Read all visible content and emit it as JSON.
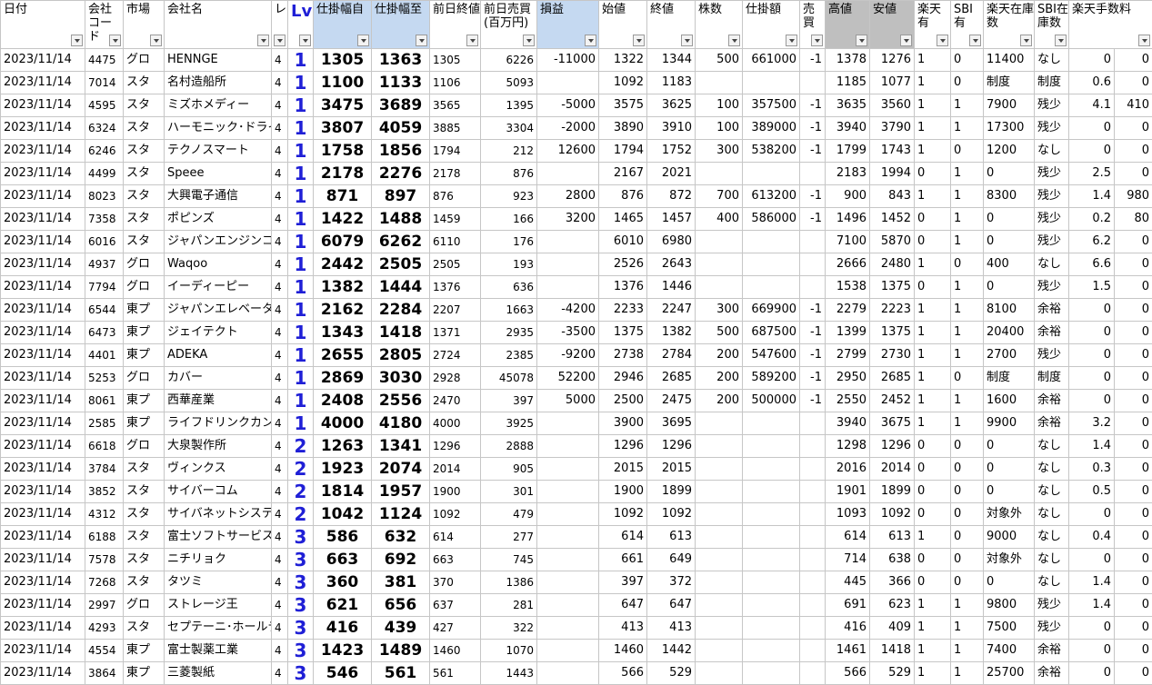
{
  "headers": [
    {
      "label": "日付",
      "style": ""
    },
    {
      "label": "会社コード",
      "style": ""
    },
    {
      "label": "市場",
      "style": ""
    },
    {
      "label": "会社名",
      "style": ""
    },
    {
      "label": "レ",
      "style": ""
    },
    {
      "label": "Lv",
      "style": "lv"
    },
    {
      "label": "仕掛幅自",
      "style": "blue"
    },
    {
      "label": "仕掛幅至",
      "style": "blue"
    },
    {
      "label": "前日終値",
      "style": ""
    },
    {
      "label": "前日売買(百万円)",
      "style": ""
    },
    {
      "label": "損益",
      "style": "blue"
    },
    {
      "label": "始値",
      "style": ""
    },
    {
      "label": "終値",
      "style": ""
    },
    {
      "label": "株数",
      "style": ""
    },
    {
      "label": "仕掛額",
      "style": ""
    },
    {
      "label": "売買",
      "style": ""
    },
    {
      "label": "高値",
      "style": "gray"
    },
    {
      "label": "安値",
      "style": "gray"
    },
    {
      "label": "楽天有",
      "style": ""
    },
    {
      "label": "SBI有",
      "style": ""
    },
    {
      "label": "楽天在庫数",
      "style": ""
    },
    {
      "label": "SBI在庫数",
      "style": ""
    },
    {
      "label": "楽天手数料",
      "style": ""
    }
  ],
  "rows": [
    [
      "2023/11/14",
      "4475",
      "グロ",
      "HENNGE",
      "4",
      "1",
      "1305",
      "1363",
      "1305",
      "6226",
      "-11000",
      "1322",
      "1344",
      "500",
      "661000",
      "-1",
      "1378",
      "1276",
      "1",
      "0",
      "11400",
      "なし",
      "0",
      "0"
    ],
    [
      "2023/11/14",
      "7014",
      "スタ",
      "名村造船所",
      "4",
      "1",
      "1100",
      "1133",
      "1106",
      "5093",
      "",
      "1092",
      "1183",
      "",
      "",
      "",
      "1185",
      "1077",
      "1",
      "0",
      "制度",
      "制度",
      "0.6",
      "0"
    ],
    [
      "2023/11/14",
      "4595",
      "スタ",
      "ミズホメディー",
      "4",
      "1",
      "3475",
      "3689",
      "3565",
      "1395",
      "-5000",
      "3575",
      "3625",
      "100",
      "357500",
      "-1",
      "3635",
      "3560",
      "1",
      "1",
      "7900",
      "残少",
      "4.1",
      "410"
    ],
    [
      "2023/11/14",
      "6324",
      "スタ",
      "ハーモニック･ドライブ",
      "4",
      "1",
      "3807",
      "4059",
      "3885",
      "3304",
      "-2000",
      "3890",
      "3910",
      "100",
      "389000",
      "-1",
      "3940",
      "3790",
      "1",
      "1",
      "17300",
      "残少",
      "0",
      "0"
    ],
    [
      "2023/11/14",
      "6246",
      "スタ",
      "テクノスマート",
      "4",
      "1",
      "1758",
      "1856",
      "1794",
      "212",
      "12600",
      "1794",
      "1752",
      "300",
      "538200",
      "-1",
      "1799",
      "1743",
      "1",
      "0",
      "1200",
      "なし",
      "0",
      "0"
    ],
    [
      "2023/11/14",
      "4499",
      "スタ",
      "Speee",
      "4",
      "1",
      "2178",
      "2276",
      "2178",
      "876",
      "",
      "2167",
      "2021",
      "",
      "",
      "",
      "2183",
      "1994",
      "0",
      "1",
      "0",
      "残少",
      "2.5",
      "0"
    ],
    [
      "2023/11/14",
      "8023",
      "スタ",
      "大興電子通信",
      "4",
      "1",
      "871",
      "897",
      "876",
      "923",
      "2800",
      "876",
      "872",
      "700",
      "613200",
      "-1",
      "900",
      "843",
      "1",
      "1",
      "8300",
      "残少",
      "1.4",
      "980"
    ],
    [
      "2023/11/14",
      "7358",
      "スタ",
      "ポピンズ",
      "4",
      "1",
      "1422",
      "1488",
      "1459",
      "166",
      "3200",
      "1465",
      "1457",
      "400",
      "586000",
      "-1",
      "1496",
      "1452",
      "0",
      "1",
      "0",
      "残少",
      "0.2",
      "80"
    ],
    [
      "2023/11/14",
      "6016",
      "スタ",
      "ジャパンエンジンコーポ",
      "4",
      "1",
      "6079",
      "6262",
      "6110",
      "176",
      "",
      "6010",
      "6980",
      "",
      "",
      "",
      "7100",
      "5870",
      "0",
      "1",
      "0",
      "残少",
      "6.2",
      "0"
    ],
    [
      "2023/11/14",
      "4937",
      "グロ",
      "Waqoo",
      "4",
      "1",
      "2442",
      "2505",
      "2505",
      "193",
      "",
      "2526",
      "2643",
      "",
      "",
      "",
      "2666",
      "2480",
      "1",
      "0",
      "400",
      "なし",
      "6.6",
      "0"
    ],
    [
      "2023/11/14",
      "7794",
      "グロ",
      "イーディーピー",
      "4",
      "1",
      "1382",
      "1444",
      "1376",
      "636",
      "",
      "1376",
      "1446",
      "",
      "",
      "",
      "1538",
      "1375",
      "0",
      "1",
      "0",
      "残少",
      "1.5",
      "0"
    ],
    [
      "2023/11/14",
      "6544",
      "東プ",
      "ジャパンエレベーター",
      "4",
      "1",
      "2162",
      "2284",
      "2207",
      "1663",
      "-4200",
      "2233",
      "2247",
      "300",
      "669900",
      "-1",
      "2279",
      "2223",
      "1",
      "1",
      "8100",
      "余裕",
      "0",
      "0"
    ],
    [
      "2023/11/14",
      "6473",
      "東プ",
      "ジェイテクト",
      "4",
      "1",
      "1343",
      "1418",
      "1371",
      "2935",
      "-3500",
      "1375",
      "1382",
      "500",
      "687500",
      "-1",
      "1399",
      "1375",
      "1",
      "1",
      "20400",
      "余裕",
      "0",
      "0"
    ],
    [
      "2023/11/14",
      "4401",
      "東プ",
      "ADEKA",
      "4",
      "1",
      "2655",
      "2805",
      "2724",
      "2385",
      "-9200",
      "2738",
      "2784",
      "200",
      "547600",
      "-1",
      "2799",
      "2730",
      "1",
      "1",
      "2700",
      "残少",
      "0",
      "0"
    ],
    [
      "2023/11/14",
      "5253",
      "グロ",
      "カバー",
      "4",
      "1",
      "2869",
      "3030",
      "2928",
      "45078",
      "52200",
      "2946",
      "2685",
      "200",
      "589200",
      "-1",
      "2950",
      "2685",
      "1",
      "0",
      "制度",
      "制度",
      "0",
      "0"
    ],
    [
      "2023/11/14",
      "8061",
      "東プ",
      "西華産業",
      "4",
      "1",
      "2408",
      "2556",
      "2470",
      "397",
      "5000",
      "2500",
      "2475",
      "200",
      "500000",
      "-1",
      "2550",
      "2452",
      "1",
      "1",
      "1600",
      "余裕",
      "0",
      "0"
    ],
    [
      "2023/11/14",
      "2585",
      "東プ",
      "ライフドリンクカンパニー",
      "4",
      "1",
      "4000",
      "4180",
      "4000",
      "3925",
      "",
      "3900",
      "3695",
      "",
      "",
      "",
      "3940",
      "3675",
      "1",
      "1",
      "9900",
      "余裕",
      "3.2",
      "0"
    ],
    [
      "2023/11/14",
      "6618",
      "グロ",
      "大泉製作所",
      "4",
      "2",
      "1263",
      "1341",
      "1296",
      "2888",
      "",
      "1296",
      "1296",
      "",
      "",
      "",
      "1298",
      "1296",
      "0",
      "0",
      "0",
      "なし",
      "1.4",
      "0"
    ],
    [
      "2023/11/14",
      "3784",
      "スタ",
      "ヴィンクス",
      "4",
      "2",
      "1923",
      "2074",
      "2014",
      "905",
      "",
      "2015",
      "2015",
      "",
      "",
      "",
      "2016",
      "2014",
      "0",
      "0",
      "0",
      "なし",
      "0.3",
      "0"
    ],
    [
      "2023/11/14",
      "3852",
      "スタ",
      "サイバーコム",
      "4",
      "2",
      "1814",
      "1957",
      "1900",
      "301",
      "",
      "1900",
      "1899",
      "",
      "",
      "",
      "1901",
      "1899",
      "0",
      "0",
      "0",
      "なし",
      "0.5",
      "0"
    ],
    [
      "2023/11/14",
      "4312",
      "スタ",
      "サイバネットシステム",
      "4",
      "2",
      "1042",
      "1124",
      "1092",
      "479",
      "",
      "1092",
      "1092",
      "",
      "",
      "",
      "1093",
      "1092",
      "0",
      "0",
      "対象外",
      "なし",
      "0",
      "0"
    ],
    [
      "2023/11/14",
      "6188",
      "スタ",
      "富士ソフトサービスビューロ",
      "4",
      "3",
      "586",
      "632",
      "614",
      "277",
      "",
      "614",
      "613",
      "",
      "",
      "",
      "614",
      "613",
      "1",
      "0",
      "9000",
      "なし",
      "0.4",
      "0"
    ],
    [
      "2023/11/14",
      "7578",
      "スタ",
      "ニチリョク",
      "4",
      "3",
      "663",
      "692",
      "663",
      "745",
      "",
      "661",
      "649",
      "",
      "",
      "",
      "714",
      "638",
      "0",
      "0",
      "対象外",
      "なし",
      "0",
      "0"
    ],
    [
      "2023/11/14",
      "7268",
      "スタ",
      "タツミ",
      "4",
      "3",
      "360",
      "381",
      "370",
      "1386",
      "",
      "397",
      "372",
      "",
      "",
      "",
      "445",
      "366",
      "0",
      "0",
      "0",
      "なし",
      "1.4",
      "0"
    ],
    [
      "2023/11/14",
      "2997",
      "グロ",
      "ストレージ王",
      "4",
      "3",
      "621",
      "656",
      "637",
      "281",
      "",
      "647",
      "647",
      "",
      "",
      "",
      "691",
      "623",
      "1",
      "1",
      "9800",
      "残少",
      "1.4",
      "0"
    ],
    [
      "2023/11/14",
      "4293",
      "スタ",
      "セプテーニ･ホールディングス",
      "4",
      "3",
      "416",
      "439",
      "427",
      "322",
      "",
      "413",
      "413",
      "",
      "",
      "",
      "416",
      "409",
      "1",
      "1",
      "7500",
      "残少",
      "0",
      "0"
    ],
    [
      "2023/11/14",
      "4554",
      "東プ",
      "富士製薬工業",
      "4",
      "3",
      "1423",
      "1489",
      "1460",
      "1070",
      "",
      "1460",
      "1442",
      "",
      "",
      "",
      "1461",
      "1418",
      "1",
      "1",
      "7400",
      "余裕",
      "0",
      "0"
    ],
    [
      "2023/11/14",
      "3864",
      "東プ",
      "三菱製紙",
      "4",
      "3",
      "546",
      "561",
      "561",
      "1443",
      "",
      "566",
      "529",
      "",
      "",
      "",
      "566",
      "529",
      "1",
      "1",
      "25700",
      "余裕",
      "0",
      "0"
    ]
  ]
}
